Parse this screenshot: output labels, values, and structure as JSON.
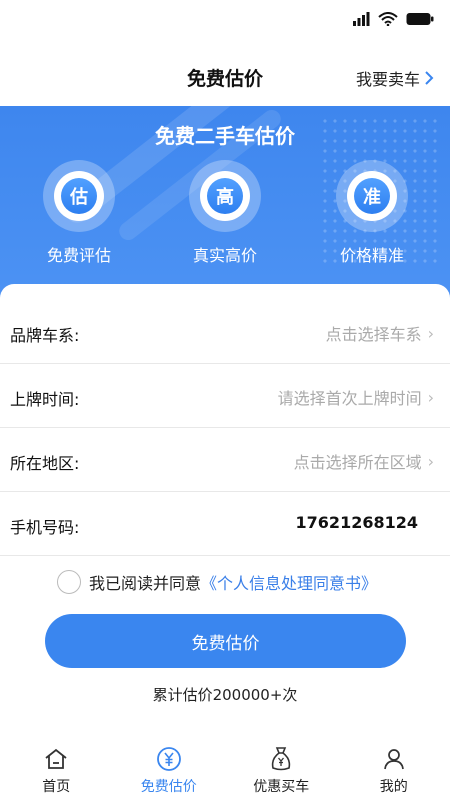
{
  "colors": {
    "accent": "#3a86ef",
    "hero": "#4a8ff2",
    "link": "#3a7fe8"
  },
  "header": {
    "title": "免费估价",
    "sell_link": "我要卖车"
  },
  "hero": {
    "title": "免费二手车估价",
    "features": [
      {
        "glyph": "估",
        "label": "免费评估"
      },
      {
        "glyph": "高",
        "label": "真实高价"
      },
      {
        "glyph": "准",
        "label": "价格精准"
      }
    ]
  },
  "form": {
    "rows": [
      {
        "label": "品牌车系:",
        "value": "点击选择车系"
      },
      {
        "label": "上牌时间:",
        "value": "请选择首次上牌时间"
      },
      {
        "label": "所在地区:",
        "value": "点击选择所在区域"
      },
      {
        "label": "手机号码:",
        "value": "17621268124"
      }
    ]
  },
  "agreement": {
    "prefix": "我已阅读并同意",
    "link": "《个人信息处理同意书》"
  },
  "submit_label": "免费估价",
  "count_text": "累计估价200000+次",
  "tabs": [
    {
      "label": "首页",
      "icon": "home-icon"
    },
    {
      "label": "免费估价",
      "icon": "yen-icon"
    },
    {
      "label": "优惠买车",
      "icon": "money-bag-icon"
    },
    {
      "label": "我的",
      "icon": "user-icon"
    }
  ]
}
